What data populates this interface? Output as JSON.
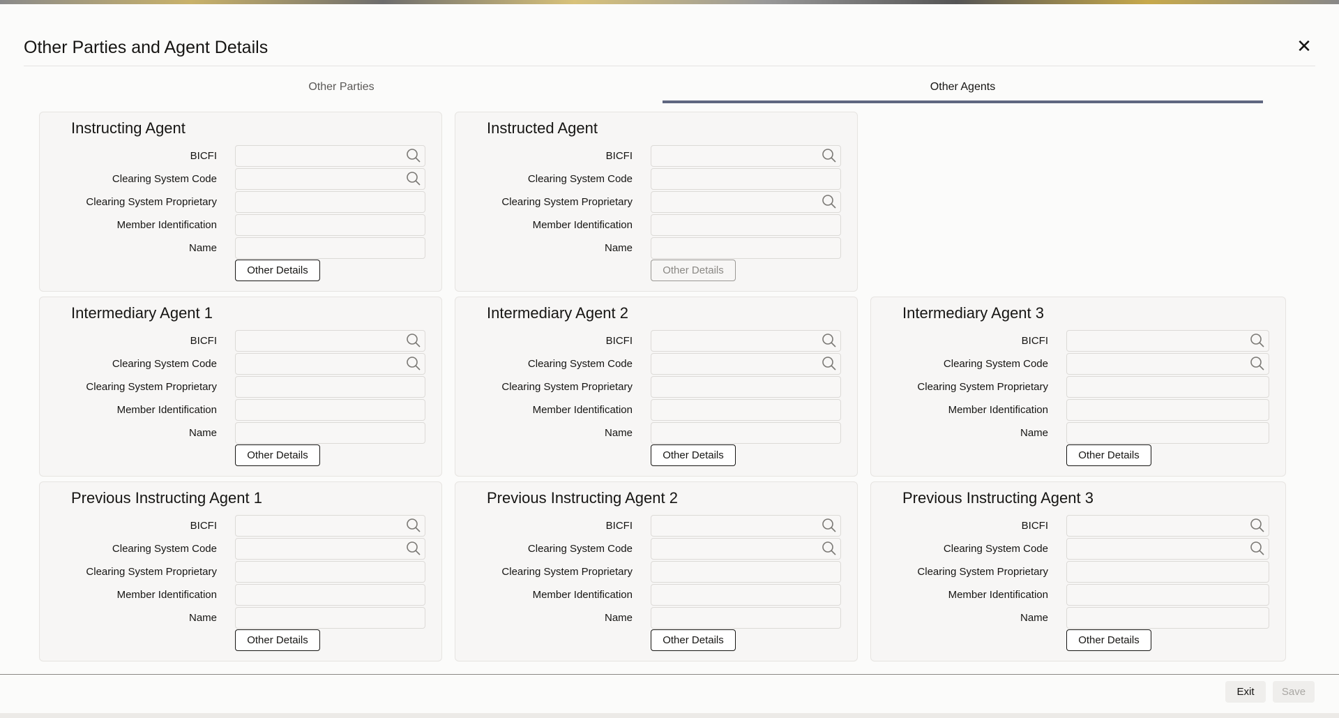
{
  "dialog": {
    "title": "Other Parties and Agent Details",
    "close_icon": "close-icon"
  },
  "tabs": [
    {
      "label": "Other Parties",
      "active": false
    },
    {
      "label": "Other Agents",
      "active": true
    }
  ],
  "panels": [
    {
      "title": "Instructing Agent",
      "search": [
        true,
        true,
        false,
        false,
        false
      ],
      "button_enabled": true
    },
    {
      "title": "Instructed Agent",
      "search": [
        true,
        false,
        true,
        false,
        false
      ],
      "button_enabled": false
    },
    null,
    {
      "title": "Intermediary Agent 1",
      "search": [
        true,
        true,
        false,
        false,
        false
      ],
      "button_enabled": true
    },
    {
      "title": "Intermediary Agent 2",
      "search": [
        true,
        true,
        false,
        false,
        false
      ],
      "button_enabled": true
    },
    {
      "title": "Intermediary Agent 3",
      "search": [
        true,
        true,
        false,
        false,
        false
      ],
      "button_enabled": true
    },
    {
      "title": "Previous Instructing Agent 1",
      "search": [
        true,
        true,
        false,
        false,
        false
      ],
      "button_enabled": true
    },
    {
      "title": "Previous Instructing Agent 2",
      "search": [
        true,
        true,
        false,
        false,
        false
      ],
      "button_enabled": true
    },
    {
      "title": "Previous Instructing Agent 3",
      "search": [
        true,
        true,
        false,
        false,
        false
      ],
      "button_enabled": true
    }
  ],
  "field_labels": [
    "BICFI",
    "Clearing System Code",
    "Clearing System Proprietary",
    "Member Identification",
    "Name"
  ],
  "field_values": [
    "",
    "",
    "",
    "",
    ""
  ],
  "other_details_label": "Other Details",
  "footer": {
    "exit": "Exit",
    "save": "Save"
  }
}
